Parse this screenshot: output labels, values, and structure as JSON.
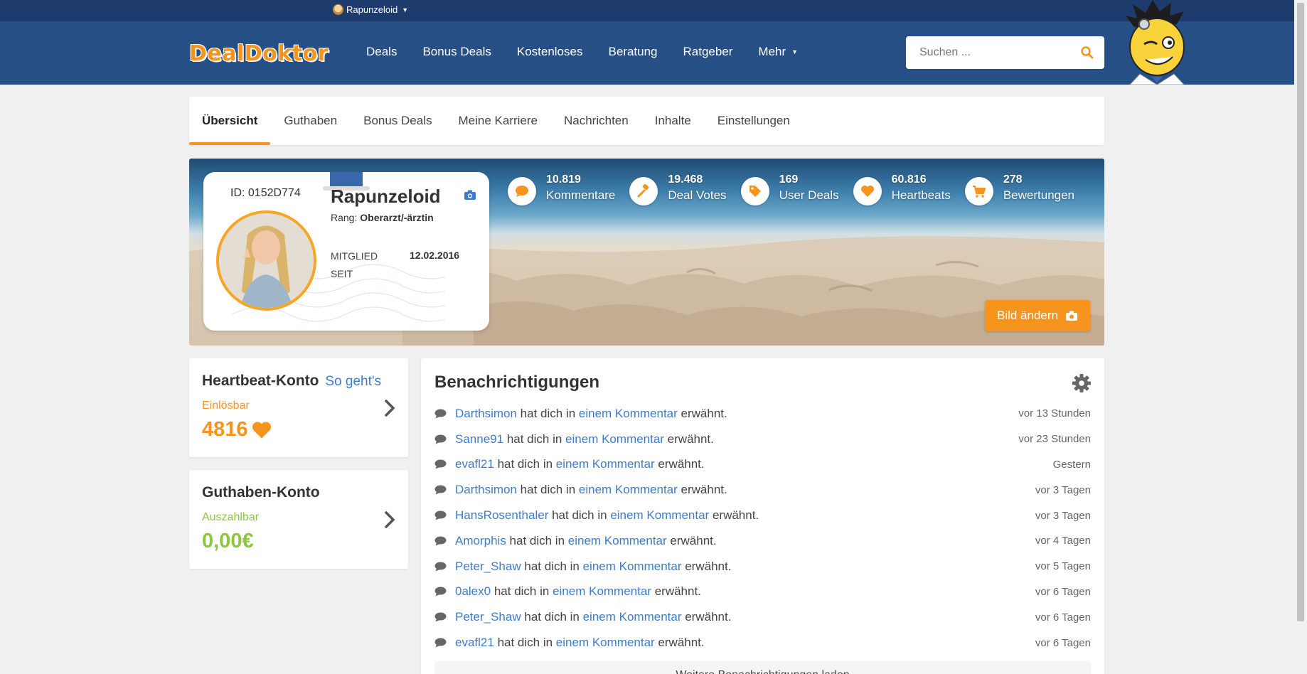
{
  "header": {
    "username": "Rapunzeloid",
    "logo": "DealDoktor",
    "nav": [
      "Deals",
      "Bonus Deals",
      "Kostenloses",
      "Beratung",
      "Ratgeber",
      "Mehr"
    ],
    "search_placeholder": "Suchen ..."
  },
  "tabs": [
    "Übersicht",
    "Guthaben",
    "Bonus Deals",
    "Meine Karriere",
    "Nachrichten",
    "Inhalte",
    "Einstellungen"
  ],
  "active_tab": "Übersicht",
  "profile": {
    "id": "ID: 0152D774",
    "name": "Rapunzeloid",
    "rank_label": "Rang:",
    "rank": "Oberarzt/-ärztin",
    "member_label": "MITGLIED SEIT",
    "member_since": "12.02.2016"
  },
  "stats": [
    {
      "value": "10.819",
      "label": "Kommentare",
      "icon": "comment-icon"
    },
    {
      "value": "19.468",
      "label": "Deal Votes",
      "icon": "hammer-icon"
    },
    {
      "value": "169",
      "label": "User Deals",
      "icon": "tag-icon"
    },
    {
      "value": "60.816",
      "label": "Heartbeats",
      "icon": "heart-icon"
    },
    {
      "value": "278",
      "label": "Bewertungen",
      "icon": "cart-icon"
    }
  ],
  "banner": {
    "change_image_label": "Bild ändern"
  },
  "heartbeat": {
    "title": "Heartbeat-Konto",
    "link": "So geht's",
    "sub": "Einlösbar",
    "value": "4816"
  },
  "credit": {
    "title": "Guthaben-Konto",
    "sub": "Auszahlbar",
    "value": "0,00€"
  },
  "notifications": {
    "title": "Benachrichtigungen",
    "mid_text": "hat dich in",
    "link_text": "einem Kommentar",
    "end_text": "erwähnt.",
    "items": [
      {
        "user": "Darthsimon",
        "time": "vor 13 Stunden"
      },
      {
        "user": "Sanne91",
        "time": "vor 23 Stunden"
      },
      {
        "user": "evafl21",
        "time": "Gestern"
      },
      {
        "user": "Darthsimon",
        "time": "vor 3 Tagen"
      },
      {
        "user": "HansRosenthaler",
        "time": "vor 3 Tagen"
      },
      {
        "user": "Amorphis",
        "time": "vor 4 Tagen"
      },
      {
        "user": "Peter_Shaw",
        "time": "vor 5 Tagen"
      },
      {
        "user": "0alex0",
        "time": "vor 6 Tagen"
      },
      {
        "user": "Peter_Shaw",
        "time": "vor 6 Tagen"
      },
      {
        "user": "evafl21",
        "time": "vor 6 Tagen"
      }
    ],
    "more_label": "Weitere Benachrichtigungen laden"
  },
  "colors": {
    "accent": "#f7941d",
    "navy": "#264f85",
    "link": "#3d7cc9",
    "green": "#8dc63f"
  }
}
